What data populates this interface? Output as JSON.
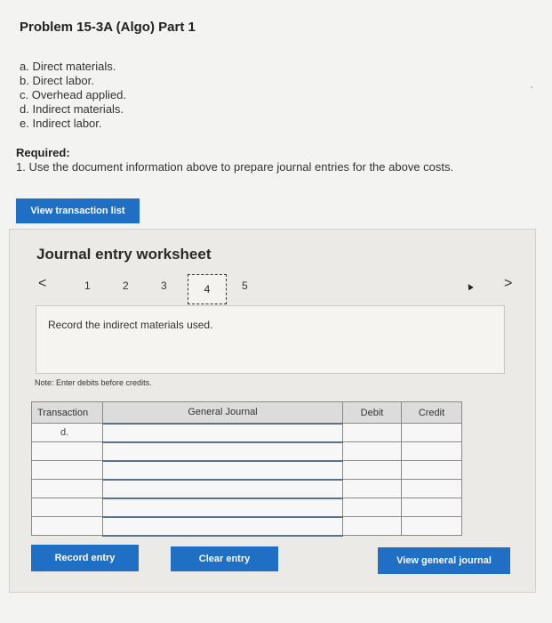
{
  "problem": {
    "title": "Problem 15-3A (Algo) Part 1",
    "items": [
      "a. Direct materials.",
      "b. Direct labor.",
      "c. Overhead applied.",
      "d. Indirect materials.",
      "e. Indirect labor."
    ],
    "required_label": "Required:",
    "required_text": "1. Use the document information above to prepare journal entries for the above costs."
  },
  "buttons": {
    "view_transaction_list": "View transaction list",
    "record_entry": "Record entry",
    "clear_entry": "Clear entry",
    "view_general_journal": "View general journal"
  },
  "worksheet": {
    "title": "Journal entry worksheet",
    "pager": {
      "prev": "<",
      "next": ">",
      "pages": [
        "1",
        "2",
        "3",
        "4",
        "5"
      ],
      "active_page": "4"
    },
    "instruction": "Record the indirect materials used.",
    "note": "Note: Enter debits before credits.",
    "table": {
      "headers": {
        "transaction": "Transaction",
        "general_journal": "General Journal",
        "debit": "Debit",
        "credit": "Credit"
      },
      "first_transaction": "d."
    }
  },
  "colors": {
    "button_blue": "#1f6fc5",
    "background": "#f3f3f1",
    "worksheet_bg": "#eceae6"
  }
}
